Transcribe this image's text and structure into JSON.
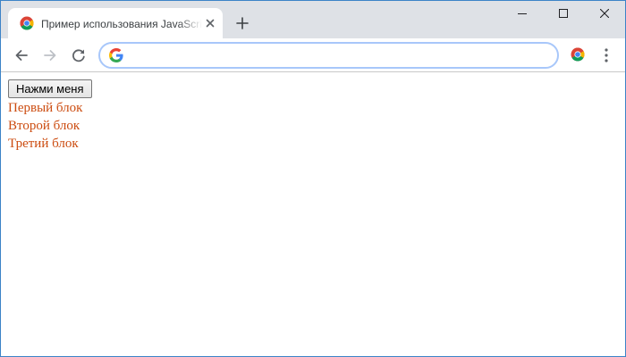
{
  "browser": {
    "tab": {
      "title": "Пример использования JavaScript",
      "favicon": "chrome-logo-icon",
      "close_icon": "close-icon"
    },
    "new_tab_icon": "plus-icon",
    "window_controls": [
      "minimize-icon",
      "maximize-icon",
      "close-icon"
    ],
    "toolbar": {
      "back_icon": "arrow-left-icon",
      "forward_icon": "arrow-right-icon",
      "reload_icon": "reload-icon",
      "omnibox": {
        "value": "",
        "icon": "google-g-icon"
      },
      "extension_icon": "chrome-logo-icon",
      "menu_icon": "kebab-menu-icon"
    },
    "colors": {
      "tabstrip_bg": "#dee1e6",
      "window_border": "#3c83c7",
      "omnibox_border": "#a8c7fa",
      "block_text": "#cc4c10"
    }
  },
  "page": {
    "button_label": "Нажми меня",
    "blocks": [
      {
        "text": "Первый блок"
      },
      {
        "text": "Второй блок"
      },
      {
        "text": "Третий блок"
      }
    ]
  }
}
